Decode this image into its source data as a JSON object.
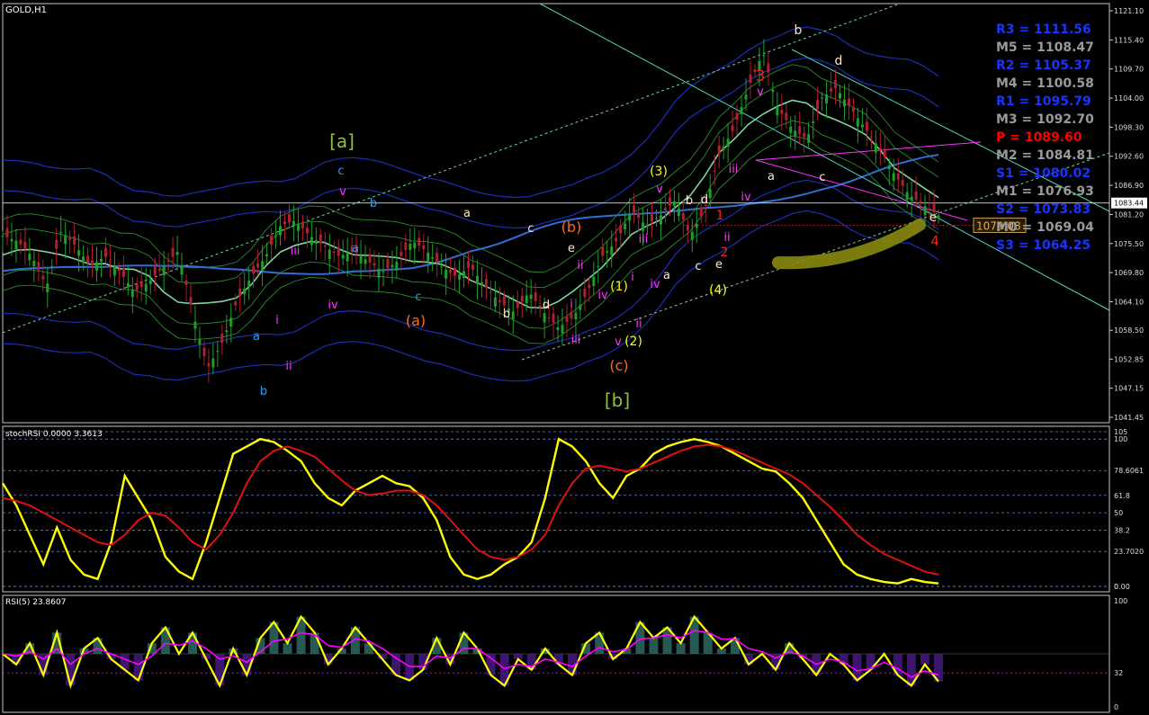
{
  "colors": {
    "background": "#000000",
    "grid": "#ffffff",
    "price_line": "#ffffff",
    "bull_candle": "#1f9e2a",
    "bear_candle": "#b0202e",
    "sma": "#2f6fd6",
    "envelope": "#1a2fb8",
    "bollinger": "#2e8b2e",
    "stoch_fast": "#ffff00",
    "stoch_slow": "#dd1111",
    "rsi_main": "#ffff00",
    "rsi_signal": "#ff00ff",
    "pivot_blue": "#1a33ff",
    "pivot_gray": "#9a9a9a",
    "pivot_red": "#ff0000",
    "channel_cyan": "#4fd6c0",
    "olive_zone": "#8a8a10"
  },
  "chart_data": [
    {
      "type": "line",
      "title": "GOLD,H1",
      "symbol": "GOLD",
      "timeframe": "H1",
      "ylim": [
        1041.45,
        1121.1
      ],
      "y_tick_labels": [
        "1121.10",
        "1115.40",
        "1109.70",
        "1104.00",
        "1098.30",
        "1092.60",
        "1086.90",
        "1081.20",
        "1075.50",
        "1069.80",
        "1064.10",
        "1058.50",
        "1052.85",
        "1047.15",
        "1041.45"
      ],
      "current_price_label": "1083.44",
      "crosshair_price_label": "1079.08",
      "close_path": [
        [
          0,
          1077
        ],
        [
          5,
          1076
        ],
        [
          10,
          1073
        ],
        [
          15,
          1067
        ],
        [
          20,
          1078
        ],
        [
          25,
          1075
        ],
        [
          30,
          1071
        ],
        [
          35,
          1073
        ],
        [
          40,
          1070
        ],
        [
          45,
          1066
        ],
        [
          50,
          1068
        ],
        [
          55,
          1071
        ],
        [
          60,
          1074
        ],
        [
          65,
          1062
        ],
        [
          70,
          1051
        ],
        [
          75,
          1056
        ],
        [
          80,
          1064
        ],
        [
          85,
          1069
        ],
        [
          90,
          1073
        ],
        [
          95,
          1079
        ],
        [
          100,
          1080
        ],
        [
          105,
          1077
        ],
        [
          110,
          1075
        ],
        [
          115,
          1073
        ],
        [
          120,
          1074
        ],
        [
          125,
          1072
        ],
        [
          130,
          1070
        ],
        [
          135,
          1072
        ],
        [
          140,
          1076
        ],
        [
          145,
          1074
        ],
        [
          150,
          1071
        ],
        [
          155,
          1069
        ],
        [
          160,
          1071
        ],
        [
          165,
          1067
        ],
        [
          170,
          1064
        ],
        [
          175,
          1062
        ],
        [
          180,
          1066
        ],
        [
          185,
          1062
        ],
        [
          190,
          1059
        ],
        [
          195,
          1061
        ],
        [
          200,
          1066
        ],
        [
          205,
          1073
        ],
        [
          210,
          1076
        ],
        [
          215,
          1082
        ],
        [
          220,
          1079
        ],
        [
          225,
          1081
        ],
        [
          230,
          1084
        ],
        [
          235,
          1077
        ],
        [
          240,
          1082
        ],
        [
          245,
          1093
        ],
        [
          250,
          1098
        ],
        [
          255,
          1106
        ],
        [
          260,
          1113
        ],
        [
          265,
          1102
        ],
        [
          270,
          1098
        ],
        [
          275,
          1096
        ],
        [
          280,
          1104
        ],
        [
          285,
          1106
        ],
        [
          290,
          1102
        ],
        [
          295,
          1098
        ],
        [
          300,
          1094
        ],
        [
          305,
          1089
        ],
        [
          310,
          1085
        ],
        [
          315,
          1083
        ],
        [
          320,
          1081
        ]
      ],
      "wave_labels": [
        {
          "text": "[a]",
          "color": "#8fbf3f"
        },
        {
          "text": "[b]",
          "color": "#8fbf3f"
        },
        {
          "text": "c",
          "color": "#1fa0ff"
        },
        {
          "text": "v",
          "color": "#ff33ff"
        },
        {
          "text": "b",
          "color": "#1fa0ff"
        },
        {
          "text": "a",
          "color": "#1fa0ff"
        },
        {
          "text": "iii",
          "color": "#ff33ff"
        },
        {
          "text": "iv",
          "color": "#ff33ff"
        },
        {
          "text": "i",
          "color": "#ff33ff"
        },
        {
          "text": "ii",
          "color": "#ff33ff"
        },
        {
          "text": "a",
          "color": "#1fa0ff"
        },
        {
          "text": "b",
          "color": "#1fa0ff"
        },
        {
          "text": "c",
          "color": "#1fa0ff"
        },
        {
          "text": "(a)",
          "color": "#ff6a1a"
        },
        {
          "text": "a",
          "color": "#ffe6c8"
        },
        {
          "text": "c",
          "color": "#ffe6c8"
        },
        {
          "text": "(b)",
          "color": "#ff6a1a"
        },
        {
          "text": "e",
          "color": "#ffe6c8"
        },
        {
          "text": "b",
          "color": "#ffe6c8"
        },
        {
          "text": "d",
          "color": "#ffe6c8"
        },
        {
          "text": "ii",
          "color": "#ff33ff"
        },
        {
          "text": "i",
          "color": "#ff33ff"
        },
        {
          "text": "iv",
          "color": "#ff33ff"
        },
        {
          "text": "iii",
          "color": "#ff33ff"
        },
        {
          "text": "v",
          "color": "#ff33ff"
        },
        {
          "text": "(c)",
          "color": "#ff6a1a"
        },
        {
          "text": "(1)",
          "color": "#ffff00"
        },
        {
          "text": "(2)",
          "color": "#ffff00"
        },
        {
          "text": "ii",
          "color": "#ff33ff"
        },
        {
          "text": "i",
          "color": "#ff33ff"
        },
        {
          "text": "(3)",
          "color": "#ffff00"
        },
        {
          "text": "v",
          "color": "#ff33ff"
        },
        {
          "text": "iii",
          "color": "#ff33ff"
        },
        {
          "text": "iv",
          "color": "#ff33ff"
        },
        {
          "text": "a",
          "color": "#ffe6c8"
        },
        {
          "text": "b",
          "color": "#ffe6c8"
        },
        {
          "text": "d",
          "color": "#ffe6c8"
        },
        {
          "text": "c",
          "color": "#ffe6c8"
        },
        {
          "text": "e",
          "color": "#ffe6c8"
        },
        {
          "text": "(4)",
          "color": "#ffff00"
        },
        {
          "text": "1",
          "color": "#ff2020"
        },
        {
          "text": "2",
          "color": "#ff2020"
        },
        {
          "text": "ii",
          "color": "#ff33ff"
        },
        {
          "text": "iii",
          "color": "#ff33ff"
        },
        {
          "text": "iv",
          "color": "#ff33ff"
        },
        {
          "text": "a",
          "color": "#ffe6c8"
        },
        {
          "text": "3",
          "color": "#ff2020"
        },
        {
          "text": "v",
          "color": "#ff33ff"
        },
        {
          "text": "b",
          "color": "#ffe6c8"
        },
        {
          "text": "d",
          "color": "#ffe6c8"
        },
        {
          "text": "c",
          "color": "#ffe6c8"
        },
        {
          "text": "e",
          "color": "#ffe6c8"
        },
        {
          "text": "4",
          "color": "#ff2020"
        }
      ],
      "pivot_levels": [
        {
          "name": "R3",
          "value": "1111.56",
          "color": "#1a33ff"
        },
        {
          "name": "M5",
          "value": "1108.47",
          "color": "#9a9a9a"
        },
        {
          "name": "R2",
          "value": "1105.37",
          "color": "#1a33ff"
        },
        {
          "name": "M4",
          "value": "1100.58",
          "color": "#9a9a9a"
        },
        {
          "name": "R1",
          "value": "1095.79",
          "color": "#1a33ff"
        },
        {
          "name": "M3",
          "value": "1092.70",
          "color": "#9a9a9a"
        },
        {
          "name": "P",
          "value": "1089.60",
          "color": "#ff0000"
        },
        {
          "name": "M2",
          "value": "1084.81",
          "color": "#9a9a9a"
        },
        {
          "name": "S1",
          "value": "1080.02",
          "color": "#1a33ff"
        },
        {
          "name": "M1",
          "value": "1076.93",
          "color": "#9a9a9a"
        },
        {
          "name": "S2",
          "value": "1073.83",
          "color": "#1a33ff"
        },
        {
          "name": "M0",
          "value": "1069.04",
          "color": "#9a9a9a"
        },
        {
          "name": "S3",
          "value": "1064.25",
          "color": "#1a33ff"
        }
      ]
    },
    {
      "type": "line",
      "title": "stochRSI 0.0000 3.3613",
      "ylim": [
        0,
        105
      ],
      "y_tick_labels": [
        "105",
        "100",
        "78.6061",
        "61.8",
        "50",
        "38.2",
        "23.7020",
        "0.00",
        "0"
      ],
      "series": [
        {
          "color": "#ffff00",
          "values": [
            70,
            55,
            35,
            15,
            40,
            18,
            8,
            5,
            30,
            75,
            60,
            45,
            20,
            10,
            5,
            30,
            60,
            90,
            95,
            100,
            98,
            92,
            85,
            70,
            60,
            55,
            65,
            70,
            75,
            70,
            68,
            60,
            45,
            20,
            8,
            5,
            8,
            15,
            20,
            30,
            60,
            100,
            95,
            85,
            70,
            60,
            75,
            80,
            90,
            95,
            98,
            100,
            98,
            95,
            90,
            85,
            80,
            78,
            70,
            60,
            45,
            30,
            15,
            8,
            5,
            3,
            2,
            5,
            3,
            2
          ]
        },
        {
          "color": "#dd1111",
          "values": [
            60,
            58,
            55,
            50,
            45,
            40,
            35,
            30,
            28,
            35,
            45,
            50,
            48,
            40,
            30,
            25,
            35,
            50,
            70,
            85,
            92,
            95,
            92,
            88,
            80,
            72,
            65,
            62,
            63,
            65,
            65,
            62,
            55,
            45,
            35,
            25,
            20,
            18,
            20,
            25,
            35,
            55,
            70,
            80,
            82,
            80,
            78,
            80,
            84,
            88,
            92,
            95,
            96,
            95,
            92,
            88,
            84,
            80,
            76,
            70,
            62,
            54,
            45,
            35,
            28,
            22,
            18,
            14,
            10,
            8
          ]
        }
      ]
    },
    {
      "type": "line",
      "title": "RSI(5) 23.8607",
      "ylim": [
        0,
        100
      ],
      "y_tick_labels": [
        "100",
        "32",
        "0"
      ],
      "series": [
        {
          "color": "#ffff00",
          "values": [
            50,
            40,
            60,
            30,
            70,
            20,
            55,
            65,
            45,
            35,
            25,
            60,
            75,
            50,
            70,
            45,
            20,
            55,
            30,
            65,
            80,
            60,
            85,
            70,
            40,
            55,
            75,
            60,
            45,
            30,
            25,
            35,
            65,
            40,
            70,
            55,
            30,
            20,
            45,
            35,
            55,
            40,
            30,
            60,
            70,
            45,
            55,
            80,
            65,
            75,
            60,
            85,
            70,
            55,
            65,
            40,
            50,
            35,
            60,
            45,
            30,
            50,
            40,
            25,
            35,
            50,
            30,
            20,
            40,
            24
          ]
        },
        {
          "color": "#ff00ff",
          "values": [
            50,
            48,
            52,
            45,
            55,
            40,
            50,
            55,
            50,
            45,
            40,
            48,
            60,
            58,
            62,
            55,
            45,
            48,
            42,
            52,
            62,
            64,
            70,
            68,
            58,
            56,
            64,
            62,
            55,
            46,
            38,
            38,
            48,
            46,
            55,
            55,
            46,
            36,
            40,
            38,
            45,
            42,
            38,
            48,
            56,
            52,
            54,
            64,
            65,
            68,
            65,
            72,
            70,
            64,
            64,
            55,
            52,
            46,
            52,
            48,
            40,
            45,
            42,
            34,
            36,
            42,
            36,
            28,
            34,
            30
          ]
        }
      ]
    }
  ]
}
